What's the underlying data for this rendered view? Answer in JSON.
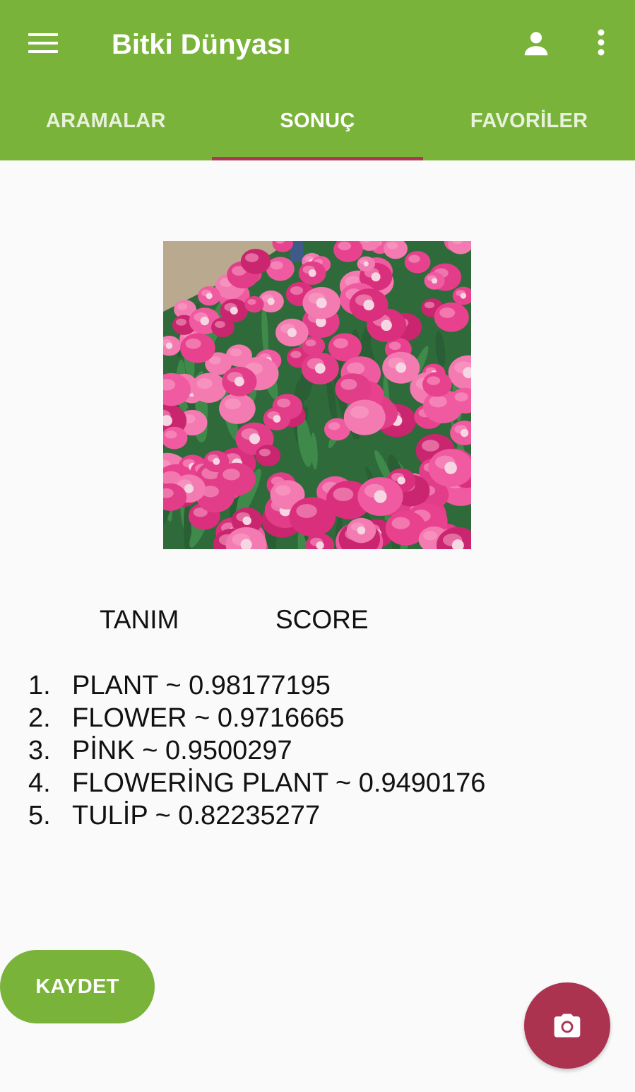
{
  "app": {
    "title": "Bitki Dünyası"
  },
  "icons": {
    "menu": "menu-icon",
    "account": "person-icon",
    "more": "more-vert-icon",
    "camera": "camera-icon"
  },
  "tabs": [
    {
      "label": "ARAMALAR",
      "active": false
    },
    {
      "label": "SONUÇ",
      "active": true
    },
    {
      "label": "FAVORİLER",
      "active": false
    }
  ],
  "result": {
    "headers": {
      "label": "TANIM",
      "score": "SCORE"
    },
    "items": [
      {
        "num": "1.",
        "text": "PLANT ~ 0.98177195"
      },
      {
        "num": "2.",
        "text": "FLOWER ~ 0.9716665"
      },
      {
        "num": "3.",
        "text": "PİNK ~ 0.9500297"
      },
      {
        "num": "4.",
        "text": "FLOWERİNG PLANT ~ 0.9490176"
      },
      {
        "num": "5.",
        "text": "TULİP ~ 0.82235277"
      }
    ]
  },
  "actions": {
    "save_label": "KAYDET"
  },
  "colors": {
    "appbar": "#7ab339",
    "tab_indicator": "#ad3a55",
    "save_button": "#7ab339",
    "camera_fab": "#ab3350"
  }
}
